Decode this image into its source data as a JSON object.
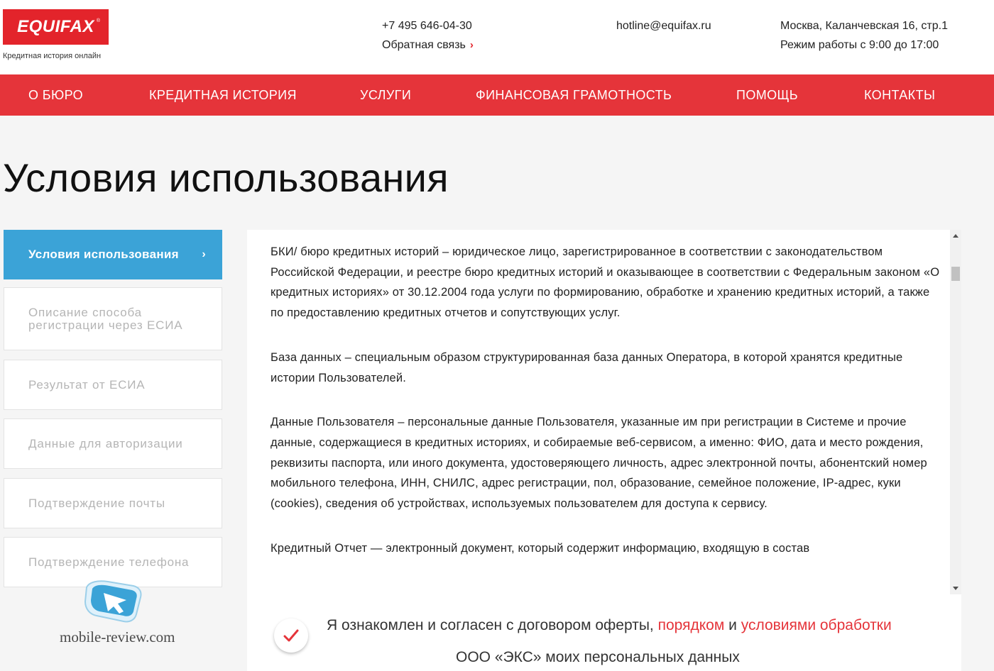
{
  "header": {
    "logo": "EQUIFAX",
    "logo_reg": "®",
    "tagline": "Кредитная история онлайн",
    "phone": "+7 495 646-04-30",
    "feedback": "Обратная связь",
    "feedback_chevron": "›",
    "email": "hotline@equifax.ru",
    "address": "Москва, Каланчевская 16, стр.1",
    "hours": "Режим работы с 9:00 до 17:00"
  },
  "nav": {
    "items": [
      "О БЮРО",
      "КРЕДИТНАЯ ИСТОРИЯ",
      "УСЛУГИ",
      "ФИНАНСОВАЯ ГРАМОТНОСТЬ",
      "ПОМОЩЬ",
      "КОНТАКТЫ"
    ]
  },
  "page": {
    "title": "Условия использования"
  },
  "sidebar": {
    "items": [
      {
        "label": "Условия использования",
        "active": true
      },
      {
        "label": "Описание способа регистрации через ЕСИА",
        "active": false
      },
      {
        "label": "Результат от ЕСИА",
        "active": false
      },
      {
        "label": "Данные для авторизации",
        "active": false
      },
      {
        "label": "Подтверждение почты",
        "active": false
      },
      {
        "label": "Подтверждение телефона",
        "active": false
      }
    ],
    "active_chevron": "›"
  },
  "content": {
    "paragraphs": [
      "БКИ/ бюро кредитных историй – юридическое лицо, зарегистрированное в соответствии с законодательством Российской Федерации, и реестре бюро кредитных историй и оказывающее в соответствии с Федеральным законом «О кредитных историях» от 30.12.2004 года услуги по формированию, обработке и хранению кредитных историй, а также по предоставлению кредитных отчетов и сопутствующих услуг.",
      "База данных – специальным образом структурированная база данных Оператора, в которой хранятся кредитные истории Пользователей.",
      "Данные Пользователя – персональные данные Пользователя, указанные им при регистрации в Системе и прочие данные, содержащиеся в кредитных историях, и собираемые веб-сервисом, а именно: ФИО, дата и место рождения, реквизиты паспорта, или иного документа, удостоверяющего личность, адрес электронной почты, абонентский номер мобильного телефона, ИНН, СНИЛС, адрес регистрации, пол, образование, семейное положение, IP-адрес, куки (cookies), сведения об устройствах, используемых пользователем для доступа к сервису.",
      "Кредитный Отчет — электронный документ, который содержит информацию, входящую в состав"
    ]
  },
  "agreement": {
    "text_before": "Я ознакомлен и согласен с договором оферты,",
    "link1": "порядком",
    "text_and": "и",
    "link2": "условиями обработки",
    "line2": "ООО «ЭКС» моих персональных данных",
    "checked": true
  },
  "watermark": {
    "text": "mobile-review.com"
  },
  "colors": {
    "brand_red": "#e3242b",
    "nav_red": "#e5343a",
    "active_blue": "#3ba3d7"
  },
  "icons": {
    "check": "check-icon",
    "chevron": "chevron-right-icon",
    "watermark": "cursor-logo-icon"
  }
}
